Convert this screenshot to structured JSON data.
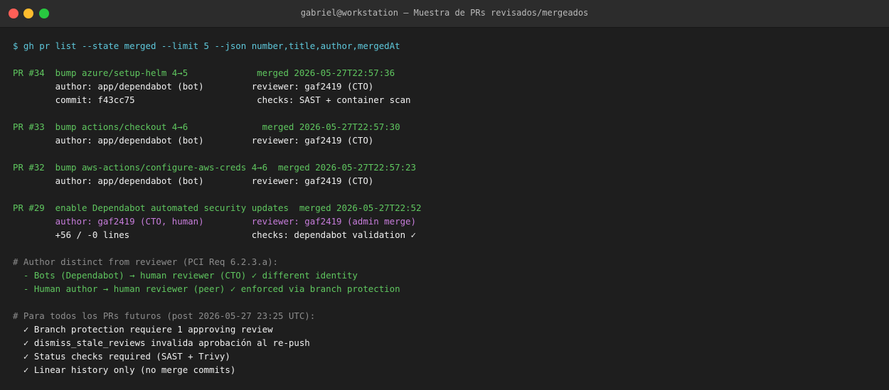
{
  "window": {
    "title": "gabriel@workstation — Muestra de PRs revisados/mergeados"
  },
  "terminal": {
    "lines": [
      [
        {
          "text": "$ gh pr list --state merged --limit 5 --json number,title,author,mergedAt",
          "color": "cyan"
        }
      ],
      [],
      [
        {
          "text": "PR #34  bump azure/setup-helm 4→5             merged 2026-05-27T22:57:36",
          "color": "green"
        }
      ],
      [
        {
          "text": "        author: app/dependabot (bot)         reviewer: gaf2419 (CTO)",
          "color": "white"
        }
      ],
      [
        {
          "text": "        commit: f43cc75                       checks: SAST + container scan",
          "color": "white"
        }
      ],
      [],
      [
        {
          "text": "PR #33  bump actions/checkout 4→6              merged 2026-05-27T22:57:30",
          "color": "green"
        }
      ],
      [
        {
          "text": "        author: app/dependabot (bot)         reviewer: gaf2419 (CTO)",
          "color": "white"
        }
      ],
      [],
      [
        {
          "text": "PR #32  bump aws-actions/configure-aws-creds 4→6  merged 2026-05-27T22:57:23",
          "color": "green"
        }
      ],
      [
        {
          "text": "        author: app/dependabot (bot)         reviewer: gaf2419 (CTO)",
          "color": "white"
        }
      ],
      [],
      [
        {
          "text": "PR #29  enable Dependabot automated security updates  merged 2026-05-27T22:52",
          "color": "green"
        }
      ],
      [
        {
          "text": "        author: gaf2419 (CTO, human)         reviewer: gaf2419 (admin merge)",
          "color": "magenta"
        }
      ],
      [
        {
          "text": "        +56 / -0 lines                       checks: dependabot validation ✓",
          "color": "white"
        }
      ],
      [],
      [
        {
          "text": "# Author distinct from reviewer (PCI Req 6.2.3.a):",
          "color": "gray"
        }
      ],
      [
        {
          "text": "  - Bots (Dependabot) → human reviewer (CTO) ✓ different identity",
          "color": "green"
        }
      ],
      [
        {
          "text": "  - Human author → human reviewer (peer) ✓ enforced via branch protection",
          "color": "green"
        }
      ],
      [],
      [
        {
          "text": "# Para todos los PRs futuros (post 2026-05-27 23:25 UTC):",
          "color": "gray"
        }
      ],
      [
        {
          "text": "  ✓ Branch protection requiere 1 approving review",
          "color": "white"
        }
      ],
      [
        {
          "text": "  ✓ dismiss_stale_reviews invalida aprobación al re-push",
          "color": "white"
        }
      ],
      [
        {
          "text": "  ✓ Status checks required (SAST + Trivy)",
          "color": "white"
        }
      ],
      [
        {
          "text": "  ✓ Linear history only (no merge commits)",
          "color": "white"
        }
      ]
    ]
  }
}
